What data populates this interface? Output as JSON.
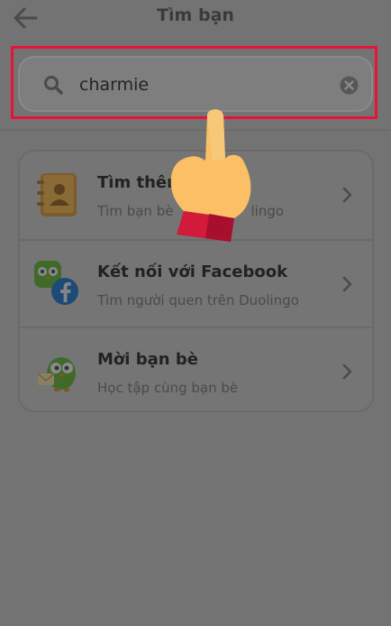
{
  "header": {
    "title": "Tìm bạn"
  },
  "search": {
    "value": "charmie"
  },
  "options": [
    {
      "title": "Tìm thên",
      "subtitle": "Tìm bạn bè",
      "subtitle_tail": "lingo"
    },
    {
      "title": "Kết nối với Facebook",
      "subtitle": "Tìm người quen trên Duolingo"
    },
    {
      "title": "Mời bạn bè",
      "subtitle": "Học tập cùng bạn bè"
    }
  ],
  "colors": {
    "highlight": "#e8123c",
    "overlay": "#737373"
  }
}
